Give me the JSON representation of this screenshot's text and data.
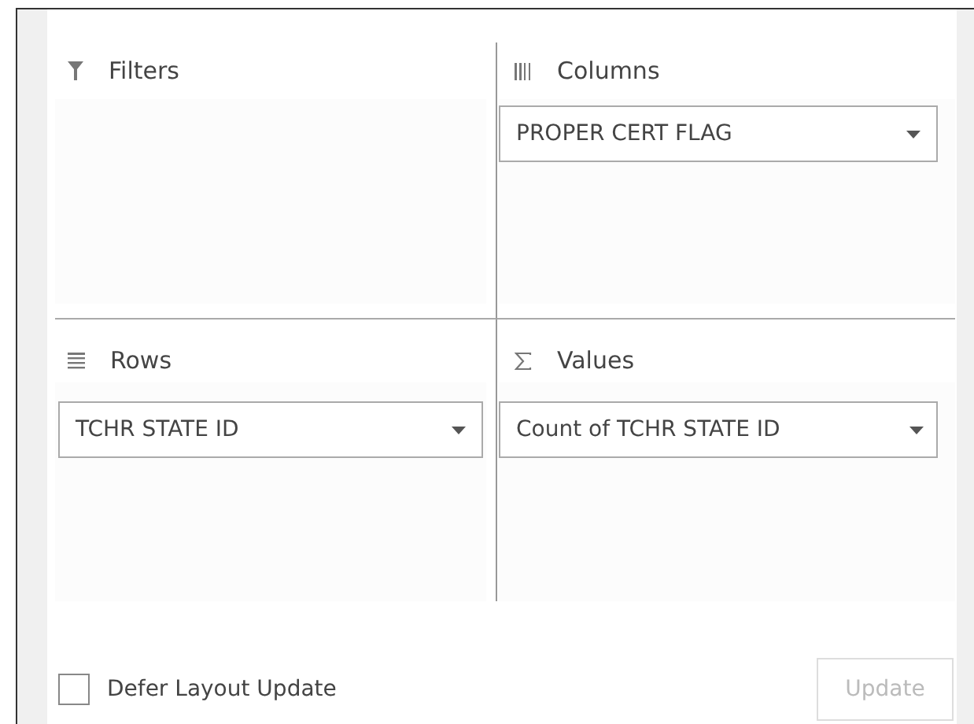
{
  "areas": [
    {
      "kind": "filters",
      "label": "Filters"
    },
    {
      "kind": "columns",
      "label": "Columns",
      "fields": [
        {
          "label": "PROPER CERT FLAG"
        }
      ]
    },
    {
      "kind": "rows",
      "label": "Rows",
      "fields": [
        {
          "label": "TCHR STATE ID"
        }
      ]
    },
    {
      "kind": "values",
      "label": "Values",
      "fields": [
        {
          "label": "Count of TCHR STATE ID"
        }
      ]
    }
  ],
  "defer": {
    "label": "Defer Layout Update",
    "checked": false
  },
  "update_button": {
    "label": "Update",
    "disabled": true
  }
}
